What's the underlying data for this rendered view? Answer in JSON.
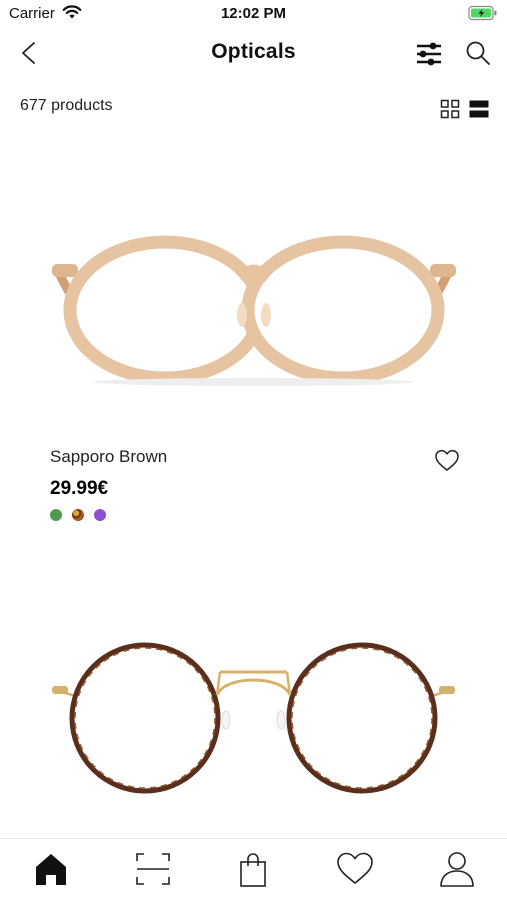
{
  "status_bar": {
    "carrier": "Carrier",
    "time": "12:02 PM",
    "battery_color": "#4cd964"
  },
  "nav": {
    "title": "Opticals",
    "back_icon": "chevron-left-icon",
    "filter_icon": "sliders-icon",
    "search_icon": "search-icon"
  },
  "results": {
    "count_label": "677 products",
    "view_modes": [
      "grid-view-icon",
      "list-view-icon"
    ],
    "selected_view": "list-view-icon"
  },
  "products": [
    {
      "name": "Sapporo Brown",
      "price": "29.99€",
      "swatches": [
        "#4e9a4a",
        "tortoise",
        "#8e4fd1"
      ],
      "frame_color": "#e6c3a1"
    },
    {
      "frame_color": "#5a2e1c",
      "bridge_color": "#d4b26a"
    }
  ],
  "tabbar": {
    "items": [
      "home-icon",
      "scan-icon",
      "bag-icon",
      "heart-icon",
      "profile-icon"
    ],
    "active": "home-icon"
  }
}
